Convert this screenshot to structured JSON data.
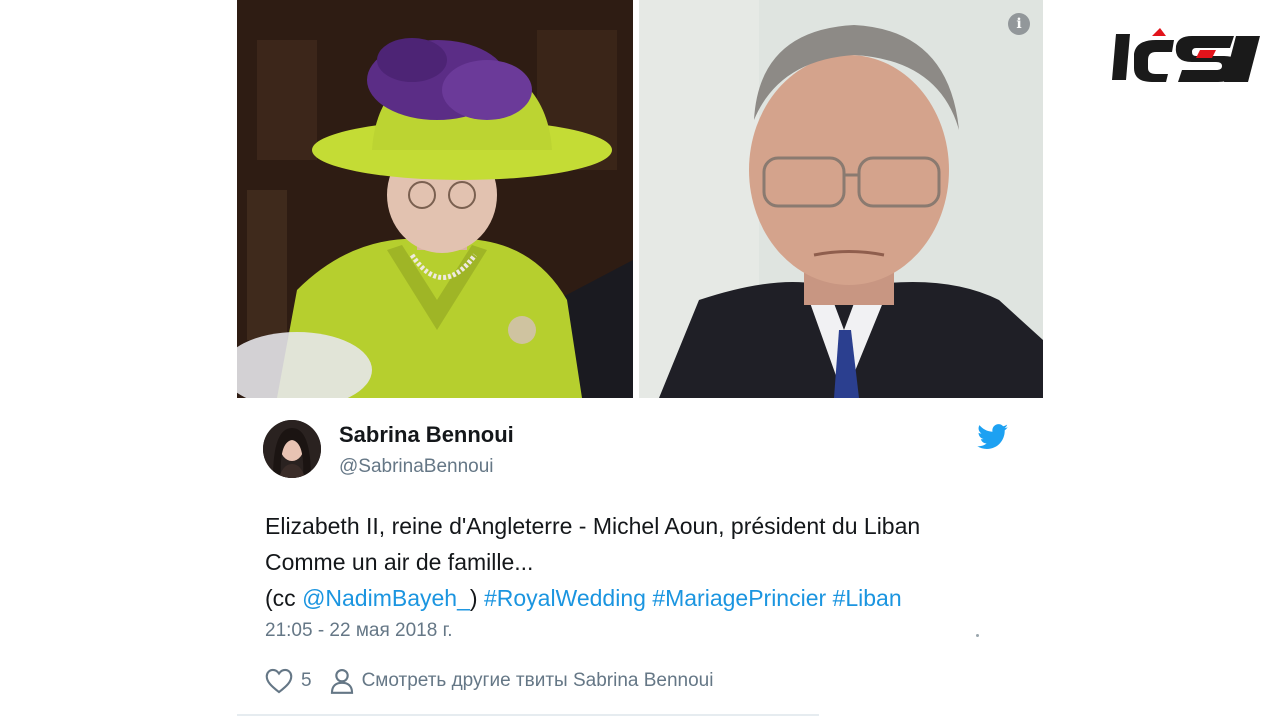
{
  "images": {
    "left_photo": {
      "icon": "photo-queen-elizabeth"
    },
    "right_photo": {
      "icon": "photo-michel-aoun"
    },
    "info_icon": {
      "glyph": "i"
    }
  },
  "tweet": {
    "author_name": "Sabrina Bennoui",
    "author_handle": "@SabrinaBennoui",
    "text_line1": "Elizabeth II, reine d'Angleterre - Michel Aoun, président du Liban",
    "text_line2": "Comme un air de famille...",
    "text_line3_prefix": "(cc ",
    "mention": "@NadimBayeh_",
    "text_line3_mid": ") ",
    "hashtags": [
      "#RoyalWedding",
      "#MariagePrincier",
      "#Liban"
    ],
    "timestamp": "21:05 - 22 мая 2018 г.",
    "like_count": "5",
    "more_tweets_label": "Смотреть другие твиты Sabrina Bennoui"
  },
  "colors": {
    "link": "#1b95e0",
    "twitter_blue": "#1da1f2",
    "secondary_text": "#657786",
    "logo_red": "#e2131b",
    "logo_black": "#1a1a1a"
  }
}
